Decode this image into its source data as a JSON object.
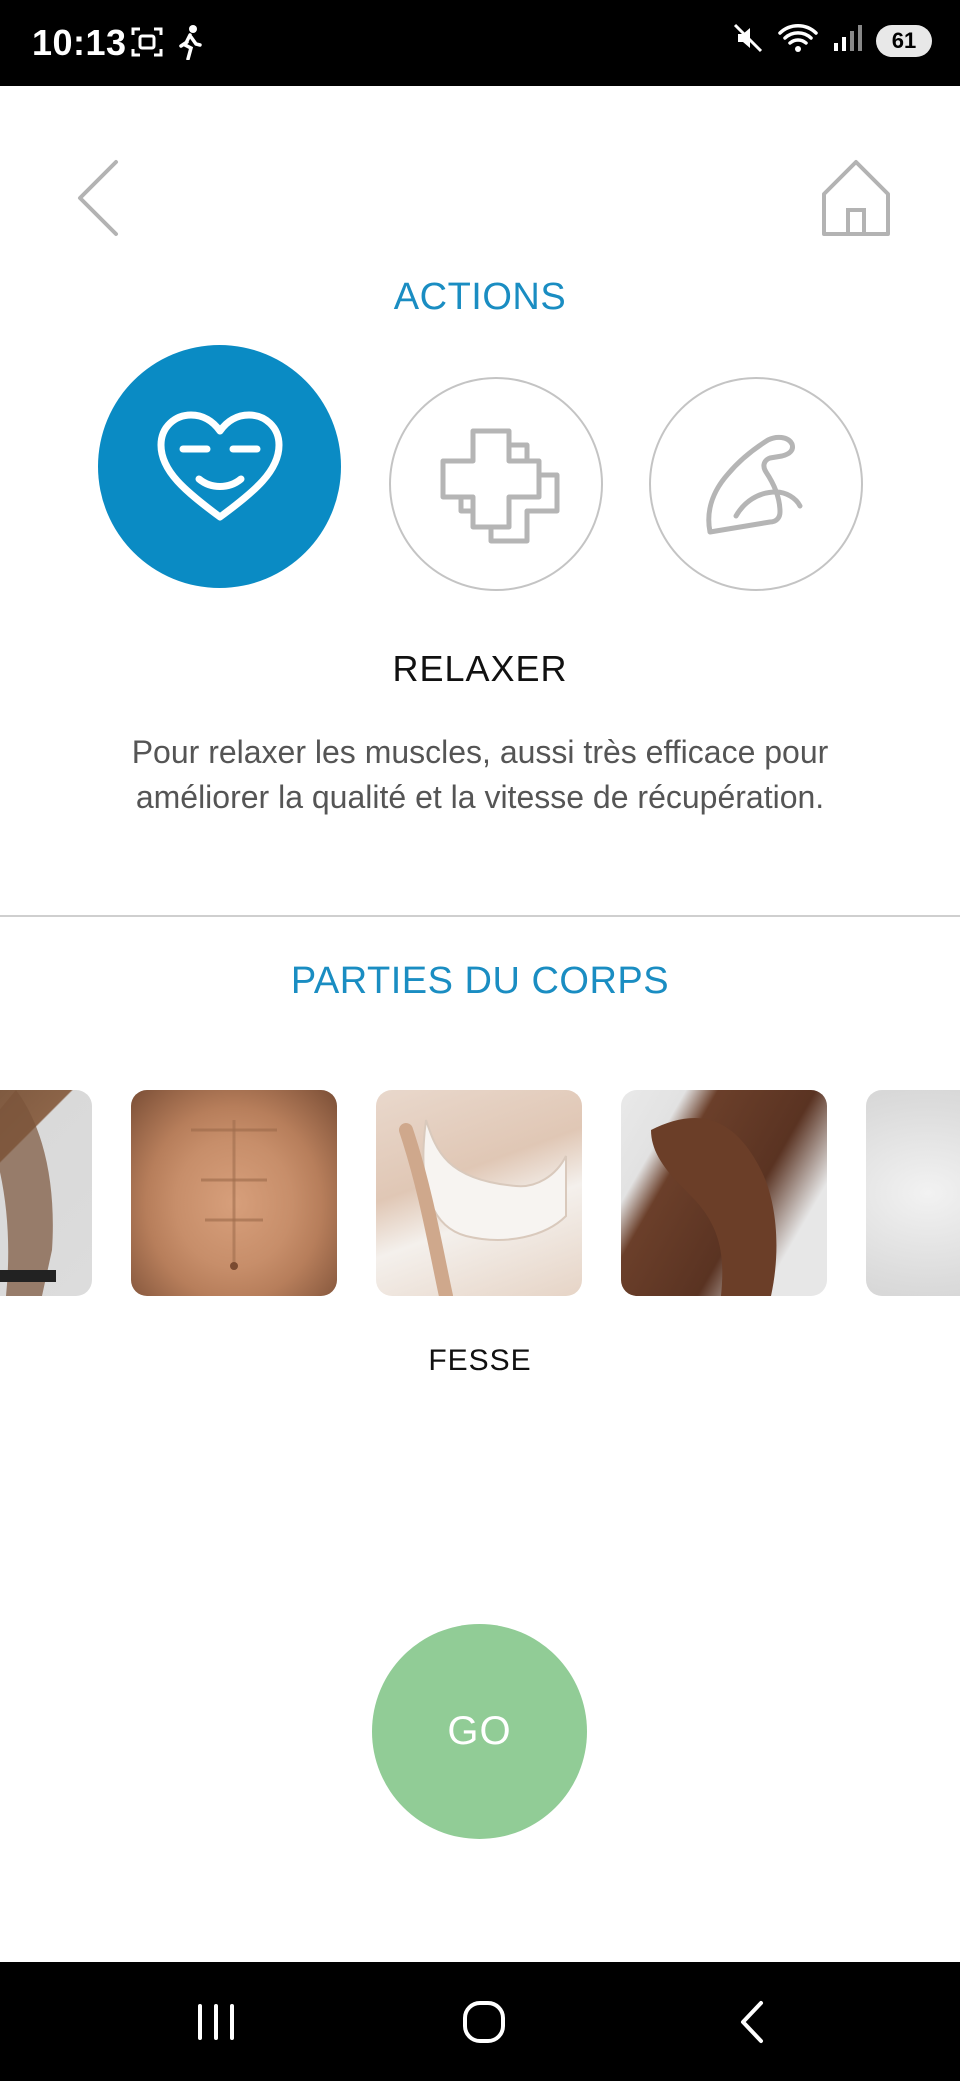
{
  "status_bar": {
    "time": "10:13",
    "battery": "61",
    "icons": [
      "screenshot-icon",
      "walking-person-icon",
      "mute-icon",
      "wifi-icon",
      "signal-icon"
    ]
  },
  "header": {
    "back_icon": "chevron-left-icon",
    "home_icon": "home-icon"
  },
  "actions": {
    "title": "ACTIONS",
    "items": [
      {
        "icon": "smiling-heart-icon",
        "selected": true
      },
      {
        "icon": "medical-cross-icon",
        "selected": false
      },
      {
        "icon": "flexed-arm-icon",
        "selected": false
      }
    ],
    "selected_name": "RELAXER",
    "selected_description": "Pour relaxer les muscles, aussi très efficace pour améliorer la qualité et la vitesse de récupération."
  },
  "body_parts": {
    "title": "PARTIES DU CORPS",
    "selected_name": "FESSE"
  },
  "go_button": {
    "label": "GO"
  },
  "colors": {
    "accent_blue": "#1a8dc2",
    "selected_circle": "#0a8bc4",
    "go_green": "#91cc96",
    "icon_gray": "#b5b5b5"
  },
  "nav_bar": {
    "icons": [
      "recents-icon",
      "home-circle-icon",
      "back-icon"
    ]
  }
}
